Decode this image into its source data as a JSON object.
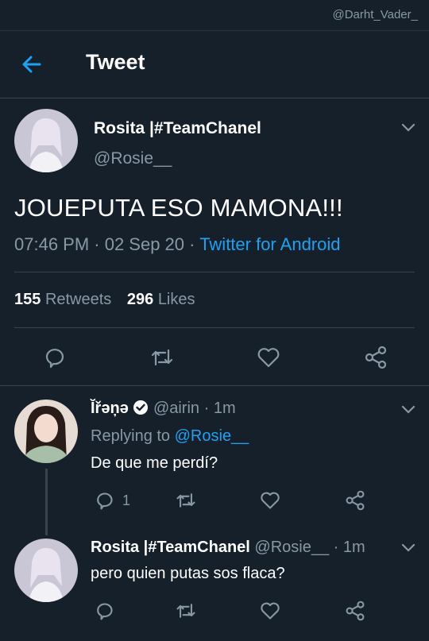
{
  "watermark": "@Darht_Vader_",
  "header": {
    "title": "Tweet"
  },
  "tweet": {
    "name": "Rosita |#TeamChanel",
    "handle": "@Rosie__",
    "text": "JOUEPUTA ESO MAMONA!!!",
    "time": "07:46 PM · 02 Sep 20 · ",
    "source": "Twitter for Android",
    "retweets_count": "155",
    "retweets_label": "Retweets",
    "likes_count": "296",
    "likes_label": "Likes"
  },
  "replies": [
    {
      "name": "Ĭřəņə",
      "handle": "@airin",
      "time": "· 1m",
      "replying_prefix": "Replying to ",
      "replying_to": "@Rosie__",
      "text": "De que me perdí?",
      "reply_count": "1"
    },
    {
      "name": "Rosita |#TeamChanel",
      "handle": "@Rosie__",
      "time": "· 1m",
      "text": "pero quien putas sos flaca?"
    }
  ],
  "colors": {
    "background": "#15202b",
    "accent": "#1da1f2",
    "muted": "#8899a6",
    "divider": "#38444d"
  }
}
